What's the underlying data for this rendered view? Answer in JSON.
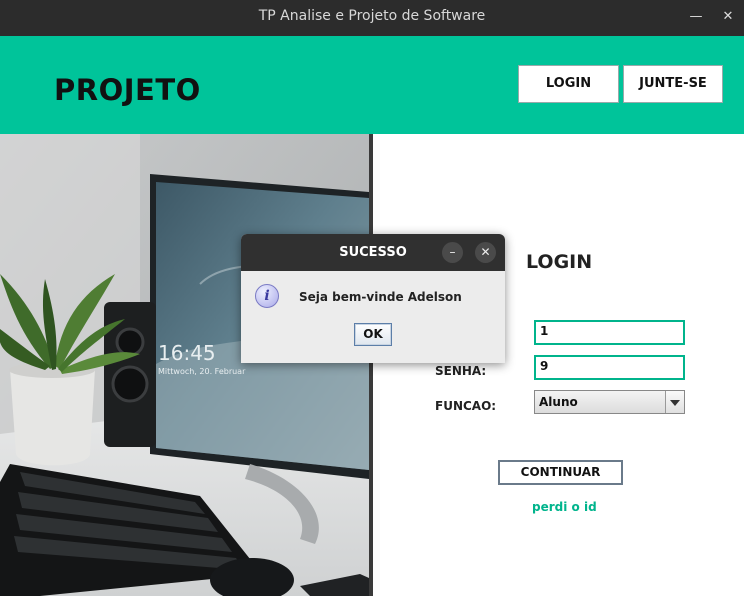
{
  "window": {
    "title": "TP Analise e Projeto de Software",
    "minimize_glyph": "—",
    "close_glyph": "✕"
  },
  "header": {
    "brand": "PROJETO",
    "login_button": "LOGIN",
    "join_button": "JUNTE-SE",
    "accent_color": "#00c49a"
  },
  "photo": {
    "monitor_clock": "16:45",
    "monitor_date": "Mittwoch, 20. Februar"
  },
  "login_form": {
    "title": "LOGIN",
    "id_value": "1",
    "password_label": "SENHA:",
    "password_value": "9",
    "role_label": "FUNCAO:",
    "role_selected": "Aluno",
    "continue_button": "CONTINUAR",
    "lost_id_link": "perdi o id"
  },
  "dialog": {
    "title": "SUCESSO",
    "minimize_glyph": "–",
    "close_glyph": "✕",
    "icon": "info-icon",
    "icon_glyph": "i",
    "message": "Seja bem-vinde Adelson",
    "ok_button": "OK"
  }
}
